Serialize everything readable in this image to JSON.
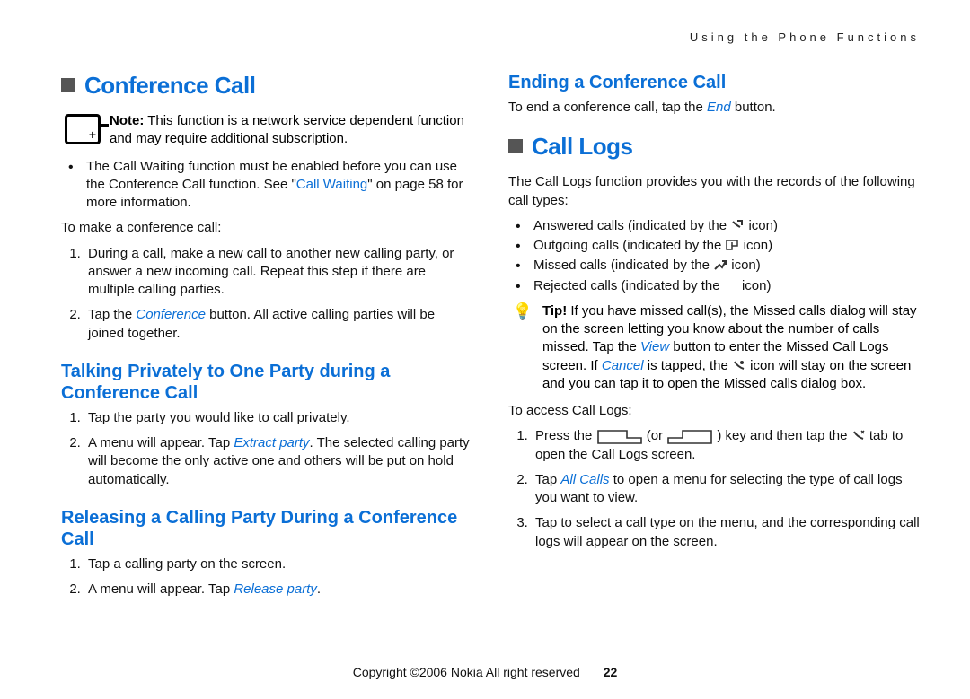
{
  "running_head": "Using the Phone Functions",
  "left": {
    "h1": "Conference Call",
    "note_bold": "Note:",
    "note_text": " This function is a network service dependent function and may require additional subscription.",
    "bullet1_a": "The Call Waiting function must be enabled before you can use the Conference Call function. See \"",
    "bullet1_link": "Call Waiting",
    "bullet1_b": "\" on page 58 for more information.",
    "p_make": "To make a conference call:",
    "ol1_1": "During a call, make a new call to another new calling party, or answer a new incoming call. Repeat this step if there are multiple calling parties.",
    "ol1_2a": "Tap the ",
    "ol1_2i": "Conference",
    "ol1_2b": " button. All active calling parties will be joined together.",
    "h2a": "Talking Privately to One Party during a Conference Call",
    "ol2_1": "Tap the party you would like to call privately.",
    "ol2_2a": "A menu will appear. Tap ",
    "ol2_2i": "Extract party",
    "ol2_2b": ". The selected calling party will become the only active one and others will be put on hold automatically.",
    "h2b": "Releasing a Calling Party During a Conference Call",
    "ol3_1": "Tap a calling party on the screen.",
    "ol3_2a": "A menu will appear. Tap ",
    "ol3_2i": "Release party",
    "ol3_2b": "."
  },
  "right": {
    "h2_end": "Ending a Conference Call",
    "p_end_a": "To end a conference call, tap the ",
    "p_end_i": "End",
    "p_end_b": " button.",
    "h1_logs": "Call Logs",
    "p_logs": "The Call Logs function provides you with the records of the following call types:",
    "b1a": "Answered calls (indicated by the ",
    "b1b": " icon)",
    "b2a": "Outgoing calls (indicated by the ",
    "b2b": " icon)",
    "b3a": "Missed calls (indicated by the ",
    "b3b": " icon)",
    "b4a": "Rejected calls (indicated by the ",
    "b4b": " icon)",
    "tip_bold": "Tip!",
    "tip_a": " If you have missed call(s), the Missed calls dialog will stay on the screen letting you know about the number of calls missed. Tap the ",
    "tip_i1": "View",
    "tip_b": " button to enter the Missed Call Logs screen. If ",
    "tip_i2": "Cancel",
    "tip_c": " is tapped, the ",
    "tip_d": " icon will stay on the screen and you can tap it to open the Missed calls dialog box.",
    "p_access": "To access Call Logs:",
    "ol1_a": "Press the ",
    "ol1_b": " (or ",
    "ol1_c": ") key and then tap the ",
    "ol1_d": " tab to open the Call Logs screen.",
    "ol2_a": "Tap ",
    "ol2_i": "All Calls",
    "ol2_b": " to open a menu for selecting the type of call logs you want to view.",
    "ol3": "Tap to select a call type on the menu, and the corresponding call logs will appear on the screen."
  },
  "footer": {
    "copy": "Copyright ©2006 Nokia All right reserved",
    "page": "22"
  }
}
